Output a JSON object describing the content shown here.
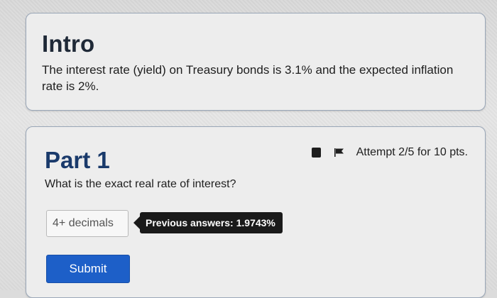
{
  "intro": {
    "title": "Intro",
    "text": "The interest rate (yield) on Treasury bonds is 3.1% and the expected inflation rate is 2%."
  },
  "part1": {
    "title": "Part 1",
    "attempt": "Attempt 2/5 for 10 pts.",
    "question": "What is the exact real rate of interest?",
    "input": {
      "placeholder": "4+ decimals",
      "value": ""
    },
    "previous_answers": "Previous answers: 1.9743%",
    "submit_label": "Submit"
  },
  "colors": {
    "submit_button": "#1d5fc8",
    "part_title": "#1a3a6b",
    "tooltip_bg": "#1a1a1a"
  },
  "icons": {
    "notes": "square-icon",
    "flag": "flag-icon"
  }
}
